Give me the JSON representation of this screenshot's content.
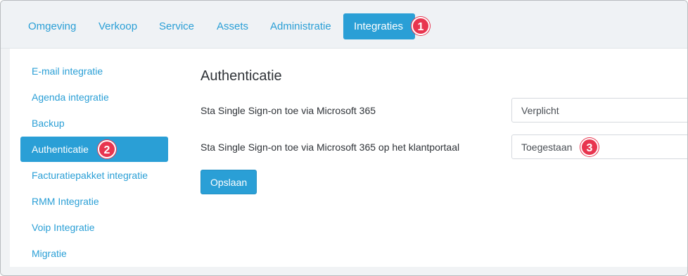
{
  "topnav": {
    "tabs": [
      {
        "label": "Omgeving"
      },
      {
        "label": "Verkoop"
      },
      {
        "label": "Service"
      },
      {
        "label": "Assets"
      },
      {
        "label": "Administratie"
      },
      {
        "label": "Integraties",
        "active": true
      }
    ],
    "badge": "1"
  },
  "sidebar": {
    "items": [
      {
        "label": "E-mail integratie"
      },
      {
        "label": "Agenda integratie"
      },
      {
        "label": "Backup"
      },
      {
        "label": "Authenticatie",
        "active": true
      },
      {
        "label": "Facturatiepakket integratie"
      },
      {
        "label": "RMM Integratie"
      },
      {
        "label": "Voip Integratie"
      },
      {
        "label": "Migratie"
      }
    ],
    "badge": "2"
  },
  "main": {
    "title": "Authenticatie",
    "settings": [
      {
        "label": "Sta Single Sign-on toe via Microsoft 365",
        "value": "Verplicht"
      },
      {
        "label": "Sta Single Sign-on toe via Microsoft 365 op het klantportaal",
        "value": "Toegestaan"
      }
    ],
    "badge": "3",
    "save_label": "Opslaan"
  },
  "colors": {
    "accent": "#2a9fd6",
    "badge": "#e8354f",
    "topbar_bg": "#eff2f5"
  }
}
